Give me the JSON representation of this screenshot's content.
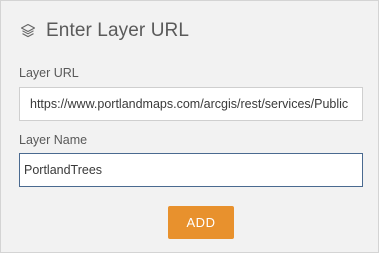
{
  "header": {
    "icon": "layers-icon",
    "title": "Enter Layer URL"
  },
  "form": {
    "url_label": "Layer URL",
    "url_value": "https://www.portlandmaps.com/arcgis/rest/services/Public",
    "name_label": "Layer Name",
    "name_value": "PortlandTrees",
    "add_label": "ADD"
  },
  "colors": {
    "accent": "#e8912d",
    "focus_border": "#4a6a90",
    "panel_bg": "#f2f2f2"
  }
}
